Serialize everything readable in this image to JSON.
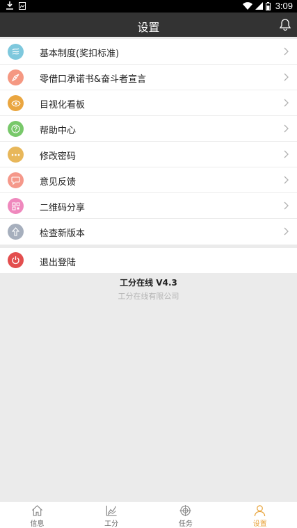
{
  "status_bar": {
    "time": "3:09"
  },
  "header": {
    "title": "设置"
  },
  "menu": {
    "items": [
      {
        "label": "基本制度(奖扣标准)",
        "icon": "document-swirl-icon",
        "color": "#7ec8dd"
      },
      {
        "label": "零借口承诺书&奋斗者宣言",
        "icon": "rocket-icon",
        "color": "#f59882"
      },
      {
        "label": "目视化看板",
        "icon": "eye-icon",
        "color": "#eaa640"
      },
      {
        "label": "帮助中心",
        "icon": "help-icon",
        "color": "#78c86a"
      },
      {
        "label": "修改密码",
        "icon": "password-dots-icon",
        "color": "#e8b75a"
      },
      {
        "label": "意见反馈",
        "icon": "chat-icon",
        "color": "#f5988a"
      },
      {
        "label": "二维码分享",
        "icon": "qrcode-icon",
        "color": "#ef88bd"
      },
      {
        "label": "检查新版本",
        "icon": "upload-arrow-icon",
        "color": "#a6afbd"
      }
    ]
  },
  "logout": {
    "label": "退出登陆",
    "icon": "power-icon",
    "color": "#e34e4e"
  },
  "footer": {
    "version": "工分在线 V4.3",
    "company": "工分在线有限公司"
  },
  "tabs": [
    {
      "label": "信息",
      "icon": "home-icon"
    },
    {
      "label": "工分",
      "icon": "chart-icon"
    },
    {
      "label": "任务",
      "icon": "target-icon"
    },
    {
      "label": "设置",
      "icon": "user-icon",
      "active": true
    }
  ],
  "colors": {
    "header_bg": "#333333",
    "accent": "#e8a33a",
    "page_bg": "#ebebeb"
  }
}
